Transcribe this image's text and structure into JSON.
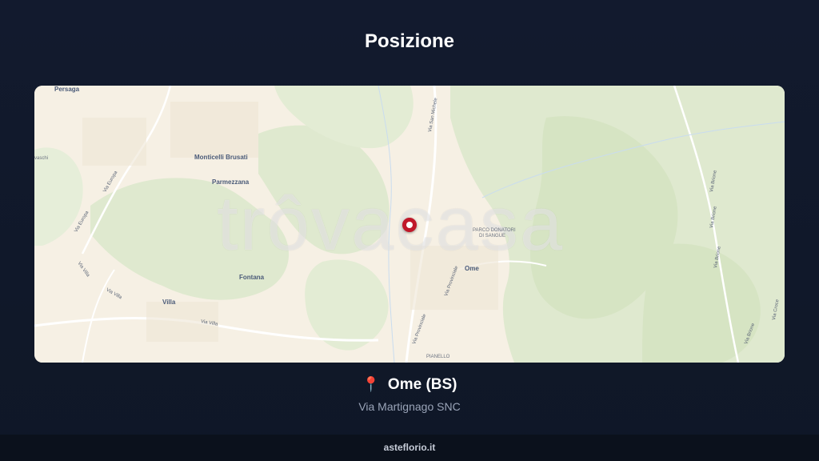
{
  "page": {
    "title": "Posizione",
    "location_name": "Ome (BS)",
    "address": "Via Martignago SNC",
    "footer": "asteflorio.it",
    "pin_icon": "location-pin-icon"
  },
  "map": {
    "watermark": "trôvacasa",
    "places": {
      "persaga": "Persaga",
      "monticelli": "Monticelli Brusati",
      "parmezzana": "Parmezzana",
      "fontana": "Fontana",
      "villa": "Villa",
      "ome": "Ome",
      "parco": "PARCO DONATORI",
      "parco2": "DI SANGUE",
      "pianello": "PIANELLO",
      "vaschi": "vaschi"
    },
    "roads": {
      "via_europa": "Via Europa",
      "via_europa2": "Via Europa",
      "via_villa1": "Via Villa",
      "via_villa2": "Via Villa",
      "via_villa3": "Via Villa",
      "via_san_michele": "Via San Michele",
      "via_provinciale1": "Via Provinciale",
      "via_provinciale2": "Via Provinciale",
      "via_brione1": "Via Brione",
      "via_brione2": "Via Brione",
      "via_brione3": "Via Brione",
      "via_croce": "Via Croce",
      "via_brione4": "Via Brione"
    },
    "colors": {
      "land": "#f6f0e4",
      "forest": "#dfe9cf",
      "forest_dark": "#d3e2c0",
      "marker": "#c0182a"
    }
  }
}
